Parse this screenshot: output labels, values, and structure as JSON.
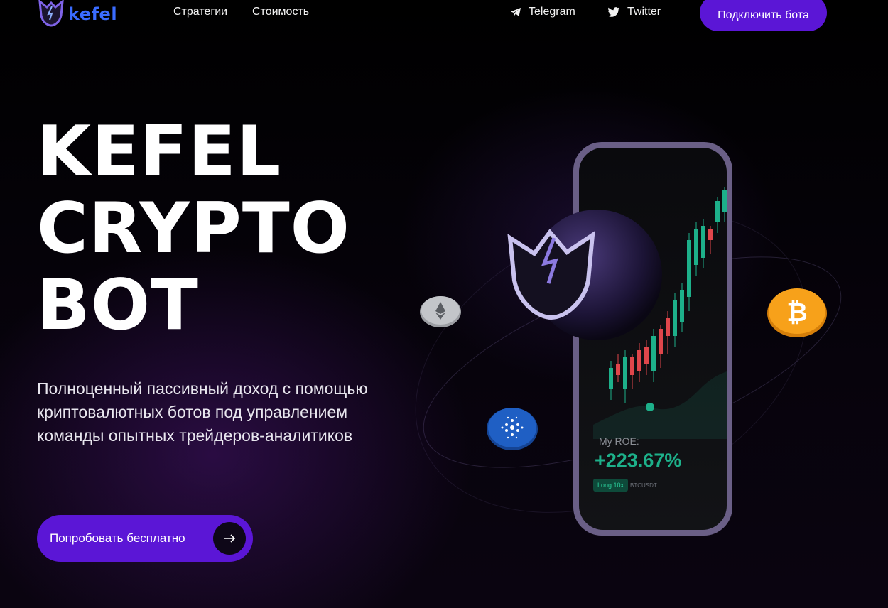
{
  "header": {
    "brand": "kefel",
    "nav": [
      "Стратегии",
      "Стоимость"
    ],
    "social": [
      {
        "label": "Telegram",
        "icon": "telegram-icon"
      },
      {
        "label": "Twitter",
        "icon": "twitter-icon"
      }
    ],
    "connect_label": "Подключить бота"
  },
  "hero": {
    "title_lines": [
      "KEFEL",
      "CRYPTO",
      "BOT"
    ],
    "subtitle": "Полноценный пассивный доход с помощью криптовалютных ботов под управлением команды опытных трейдеров-аналитиков",
    "cta_label": "Попробовать бесплатно"
  },
  "phone": {
    "roe_label": "My ROE:",
    "roe_value": "+223.67%",
    "position_tag": "Long 10x",
    "pair": "BTCUSDT"
  },
  "colors": {
    "accent": "#5b16d6",
    "brand_blue": "#3a6cff",
    "profit_green": "#1db08a",
    "candle_red": "#e0464b",
    "bitcoin": "#f7a11a",
    "cardano": "#1f5fc4"
  }
}
